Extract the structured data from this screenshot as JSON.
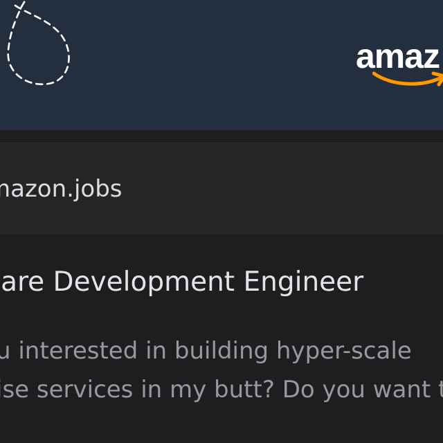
{
  "banner": {
    "logo_text": "amaz",
    "icons": {
      "decoration": "dashed-loop-icon",
      "logo_smile": "amazon-smile-arrow-icon"
    },
    "colors": {
      "banner_background": "#232f3e",
      "logo_text": "#ffffff",
      "logo_smile": "#ff9900"
    }
  },
  "source": {
    "domain": "mazon.jobs"
  },
  "job": {
    "title": "vare Development Engineer",
    "description_lines": [
      "u interested in building hyper-scale",
      "ise services in my butt? Do you want t"
    ]
  },
  "colors": {
    "page_background": "#1c1c1e",
    "title_text": "#e4e4e8",
    "description_text": "#98989e"
  }
}
